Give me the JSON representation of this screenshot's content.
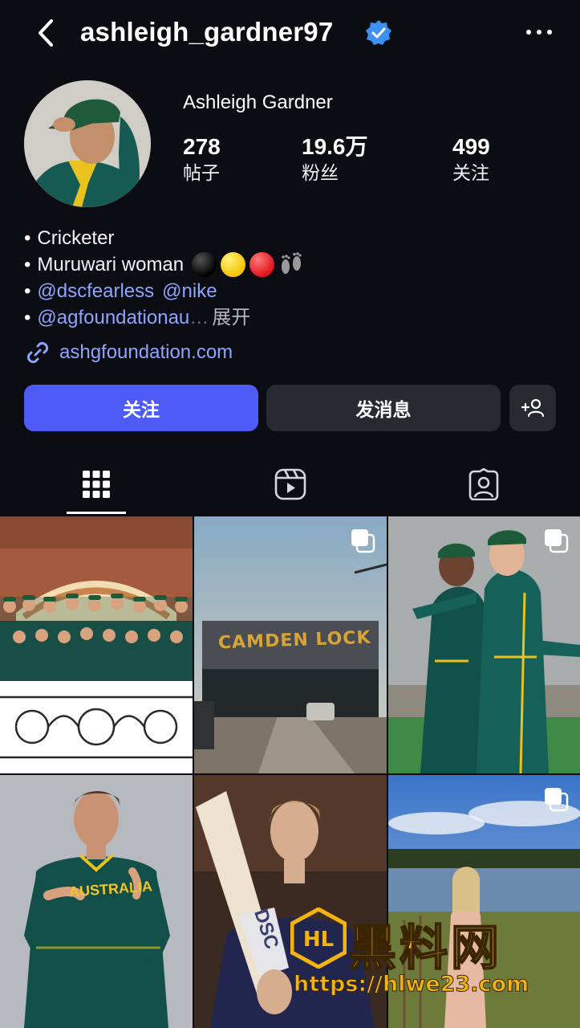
{
  "header": {
    "username": "ashleigh_gardner97",
    "back_icon": "chevron-left-icon",
    "verified_icon": "verified-badge-icon",
    "more_icon": "more-horizontal-icon"
  },
  "profile": {
    "display_name": "Ashleigh Gardner",
    "stats": {
      "posts": {
        "value": "278",
        "label": "帖子"
      },
      "followers": {
        "value": "19.6万",
        "label": "粉丝"
      },
      "following": {
        "value": "499",
        "label": "关注"
      }
    },
    "bio": {
      "bullet": "•",
      "line1": "Cricketer",
      "line2": "Muruwari woman",
      "line2_emojis": [
        "black-circle",
        "yellow-circle",
        "red-circle",
        "footprints"
      ],
      "line3_mentions": [
        "@dscfearless",
        "@nike"
      ],
      "line4_mention": "@agfoundationau",
      "line4_ellipsis": "…",
      "expand_label": "展开"
    },
    "link": {
      "text": "ashgfoundation.com",
      "icon": "link-icon"
    }
  },
  "actions": {
    "follow_label": "关注",
    "message_label": "发消息",
    "suggest_icon": "add-person-icon"
  },
  "tabs": [
    {
      "name": "posts-grid",
      "icon": "grid-icon",
      "active": true
    },
    {
      "name": "reels",
      "icon": "reels-icon",
      "active": false
    },
    {
      "name": "tagged",
      "icon": "tagged-user-icon",
      "active": false
    }
  ],
  "grid_posts": [
    {
      "subject": "team-balcony-photo",
      "multi": false
    },
    {
      "subject": "camden-lock-bridge",
      "sign_text": "CAMDEN LOCK",
      "multi": true
    },
    {
      "subject": "players-celebrating",
      "multi": true
    },
    {
      "subject": "player-portrait-jersey",
      "jersey_text": "AUSTRALIA",
      "multi": false
    },
    {
      "subject": "player-with-bat",
      "bat_text": "DSC",
      "multi": false
    },
    {
      "subject": "lakeside-portrait",
      "multi": true
    }
  ],
  "watermark": {
    "main": "黑料网",
    "url": "https://hlwe23.com",
    "logo_text": "HL"
  },
  "colors": {
    "background": "#0b0d13",
    "accent_blue": "#4f5bf7",
    "link_blue": "#8ea5ff",
    "button_dark": "#272a31",
    "watermark": "#f3b412"
  }
}
